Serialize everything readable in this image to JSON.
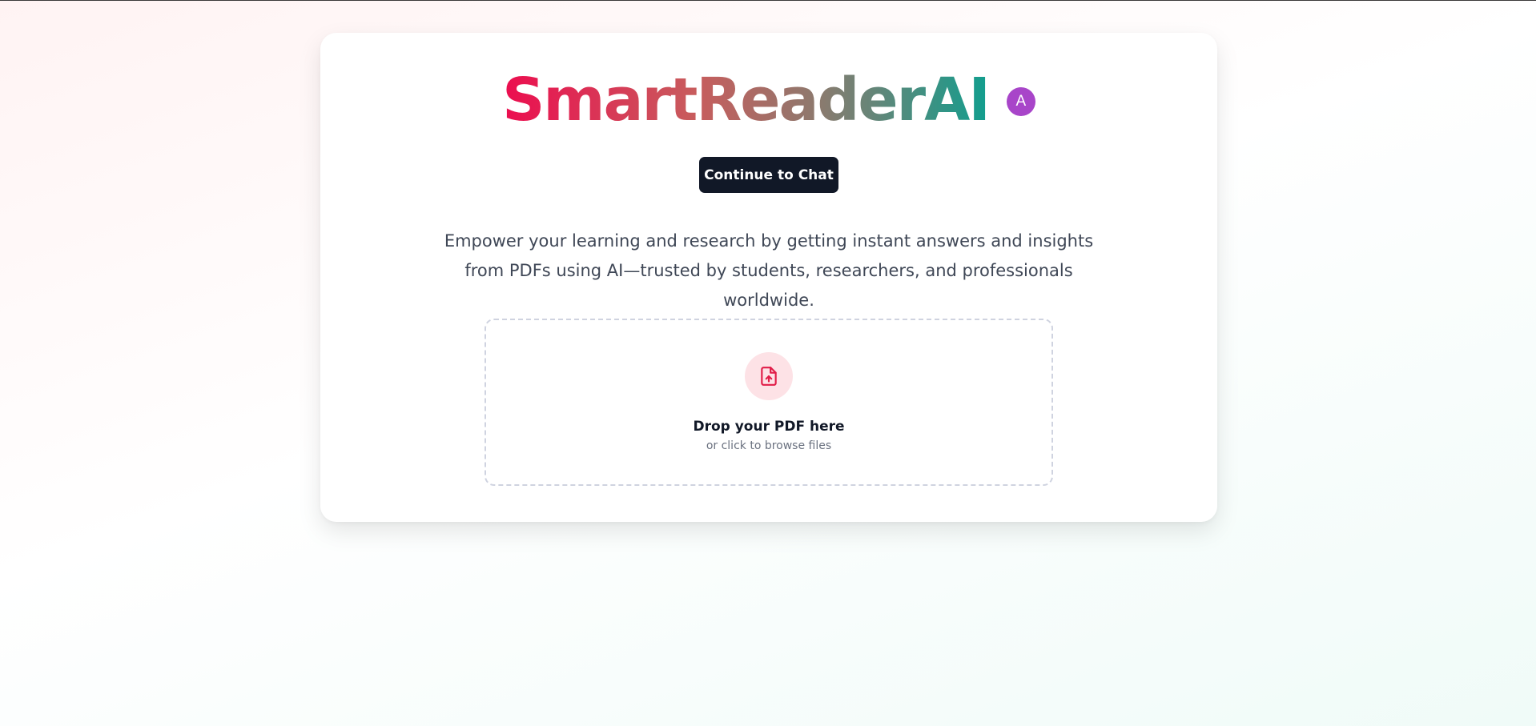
{
  "app": {
    "title": "SmartReaderAI",
    "gradient_colors": [
      "#ec0d4f",
      "#c75d5d",
      "#8c7a6e",
      "#119e8e"
    ]
  },
  "header": {
    "avatar_letter": "A",
    "avatar_color": "#a845c9"
  },
  "actions": {
    "continue_label": "Continue to Chat",
    "continue_color": "#111827"
  },
  "main": {
    "tagline": "Empower your learning and research by getting instant answers and insights from PDFs using AI—trusted by students, researchers, and professionals worldwide."
  },
  "upload": {
    "icon": "file-upload-icon",
    "icon_color": "#e11d48",
    "title": "Drop your PDF here",
    "subtitle": "or click to browse files"
  }
}
